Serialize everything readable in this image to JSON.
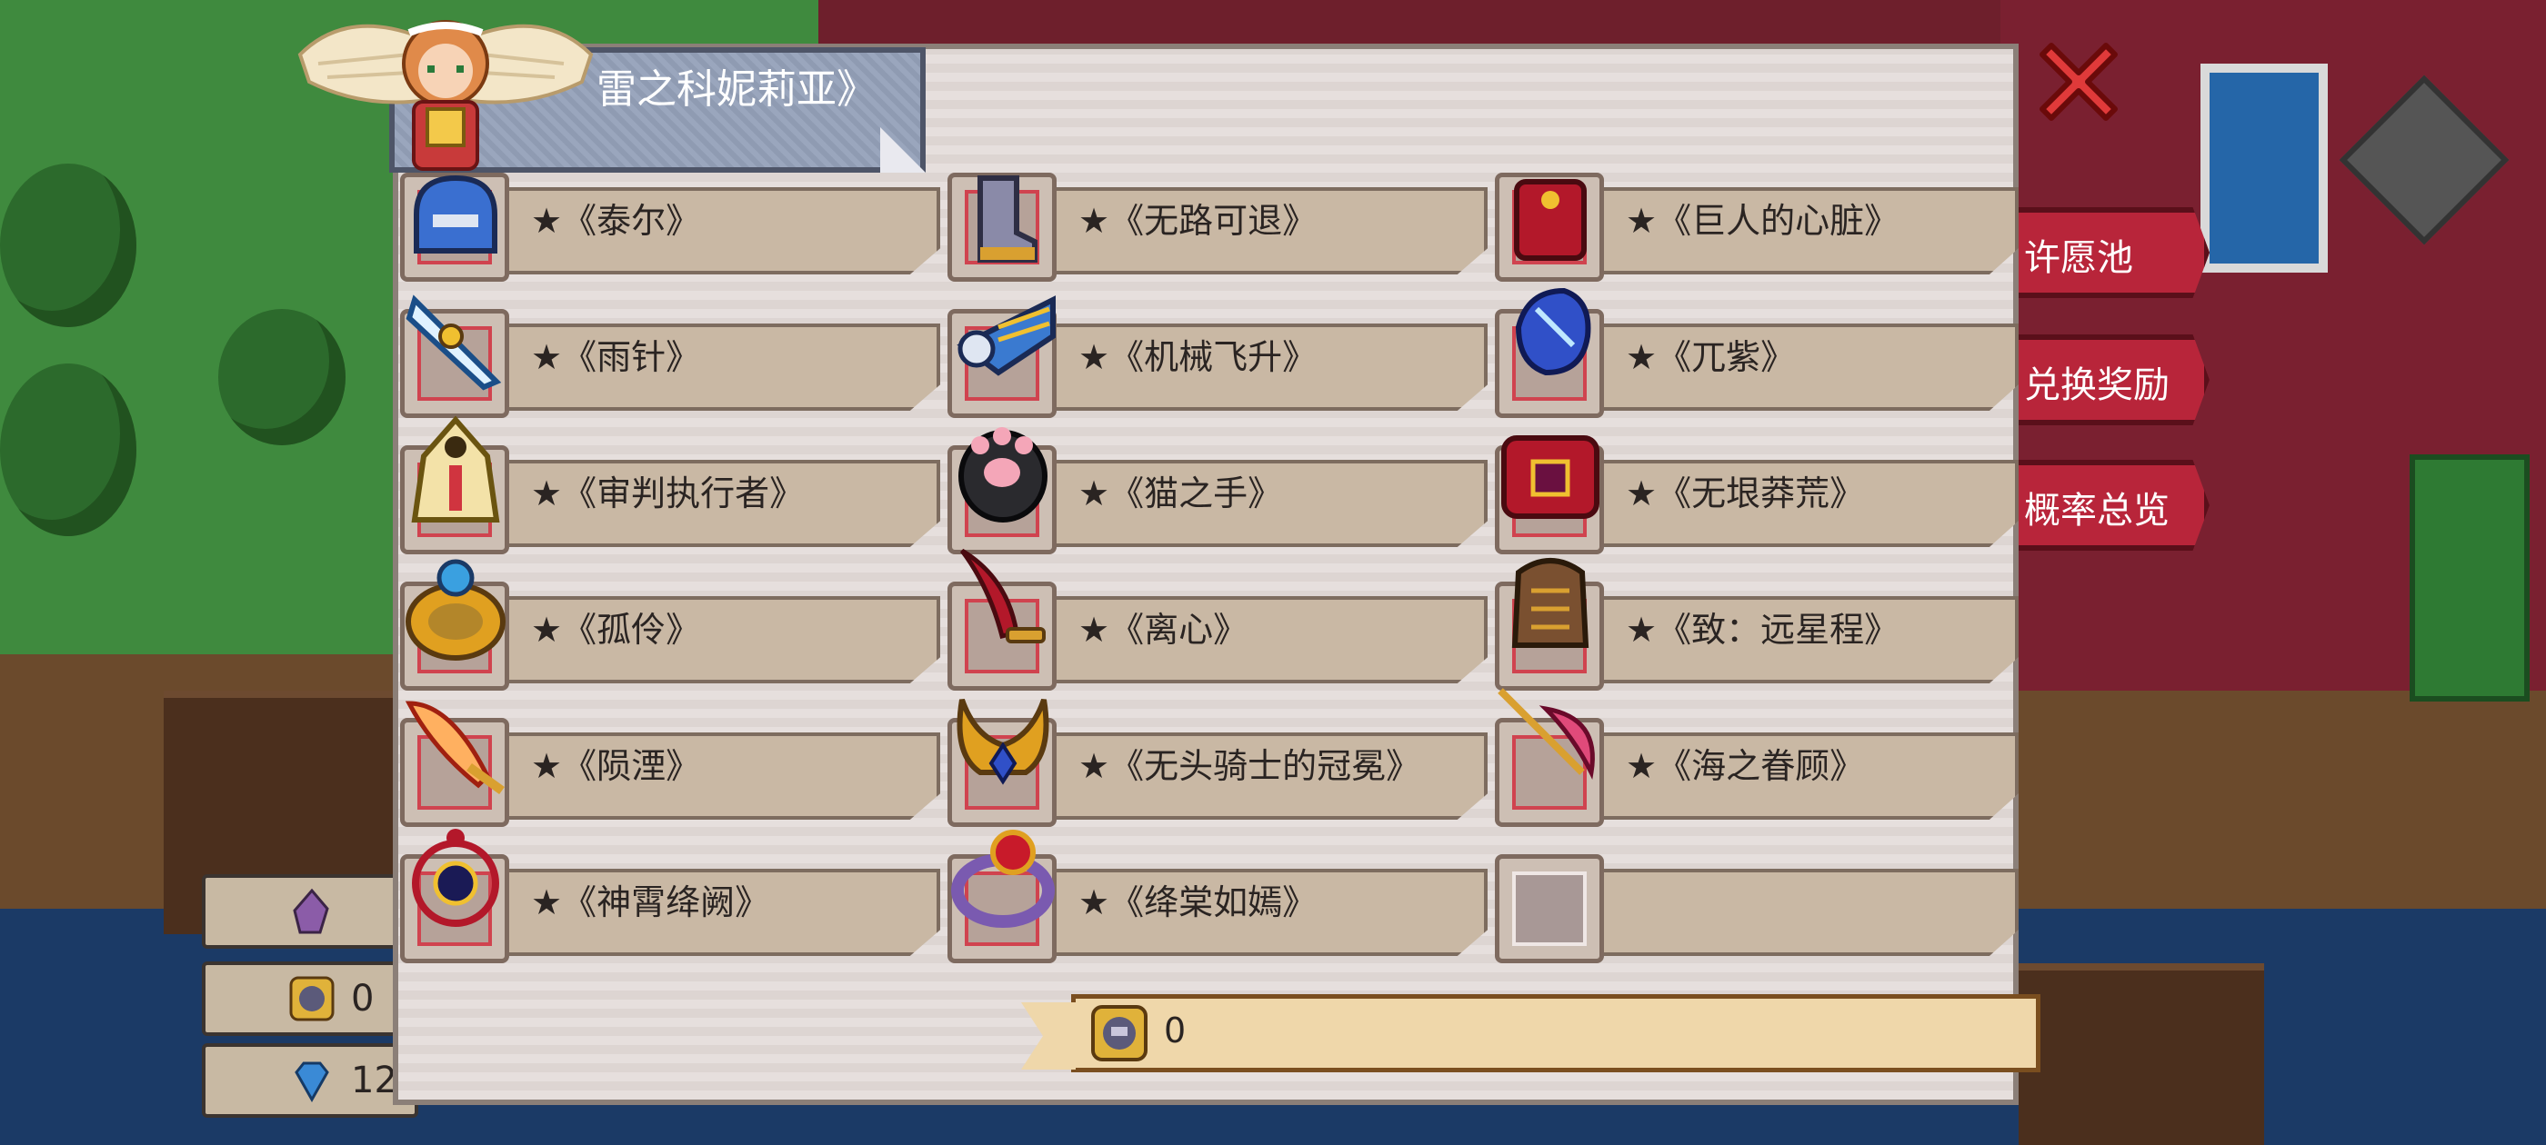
{
  "panel": {
    "title": "雷之科妮莉亚》",
    "close_icon": "close-x-icon"
  },
  "items": [
    {
      "label": "★《泰尔》",
      "icon": "helmet-icon",
      "filled": true
    },
    {
      "label": "★《无路可退》",
      "icon": "boots-icon",
      "filled": true
    },
    {
      "label": "★《巨人的心脏》",
      "icon": "red-armor-icon",
      "filled": true
    },
    {
      "label": "★《雨针》",
      "icon": "ice-blade-icon",
      "filled": true
    },
    {
      "label": "★《机械飞升》",
      "icon": "mech-wing-icon",
      "filled": true
    },
    {
      "label": "★《兀紫》",
      "icon": "blue-gauntlet-icon",
      "filled": true
    },
    {
      "label": "★《审判执行者》",
      "icon": "hooded-robe-icon",
      "filled": true
    },
    {
      "label": "★《猫之手》",
      "icon": "cat-paw-icon",
      "filled": true
    },
    {
      "label": "★《无垠莽荒》",
      "icon": "red-belt-icon",
      "filled": true
    },
    {
      "label": "★《孤伶》",
      "icon": "gold-ring-icon",
      "filled": true
    },
    {
      "label": "★《离心》",
      "icon": "red-dagger-icon",
      "filled": true
    },
    {
      "label": "★《致：远星程》",
      "icon": "brown-gauntlet-icon",
      "filled": true
    },
    {
      "label": "★《陨湮》",
      "icon": "flame-sword-icon",
      "filled": true
    },
    {
      "label": "★《无头骑士的冠冕》",
      "icon": "horned-crown-icon",
      "filled": true
    },
    {
      "label": "★《海之眷顾》",
      "icon": "pink-spear-icon",
      "filled": true
    },
    {
      "label": "★《神霄绛阙》",
      "icon": "dark-orb-amulet-icon",
      "filled": true
    },
    {
      "label": "★《绛棠如嫣》",
      "icon": "ruby-ring-icon",
      "filled": true
    },
    {
      "label": "",
      "icon": "empty-slot-icon",
      "filled": false
    }
  ],
  "currency": {
    "icon": "token-coin-icon",
    "value": "0"
  },
  "hud_left": [
    {
      "icon": "purple-crystal-icon",
      "value": ""
    },
    {
      "icon": "token-coin-icon",
      "value": "0"
    },
    {
      "icon": "blue-diamond-icon",
      "value": "12"
    }
  ],
  "side_menu": [
    {
      "label": "许愿池"
    },
    {
      "label": "兑换奖励"
    },
    {
      "label": "概率总览"
    }
  ]
}
